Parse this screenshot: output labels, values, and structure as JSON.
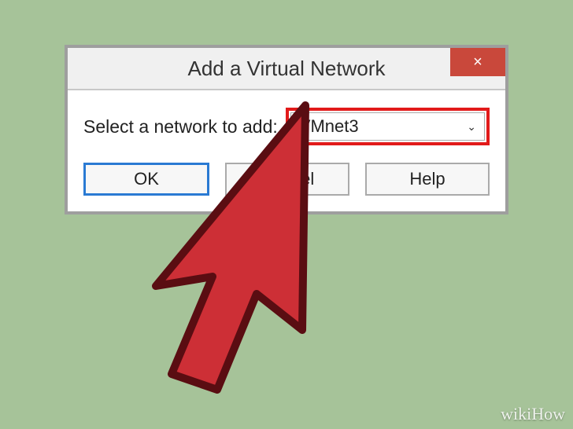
{
  "dialog": {
    "title": "Add a Virtual Network",
    "close_symbol": "×",
    "label": "Select a network to add:",
    "selected_value": "VMnet3",
    "buttons": {
      "ok": "OK",
      "cancel": "Cancel",
      "help": "Help"
    }
  },
  "watermark": "wikiHow",
  "colors": {
    "highlight": "#e21a1a",
    "close_bg": "#c9483b",
    "background": "#a6c399"
  }
}
